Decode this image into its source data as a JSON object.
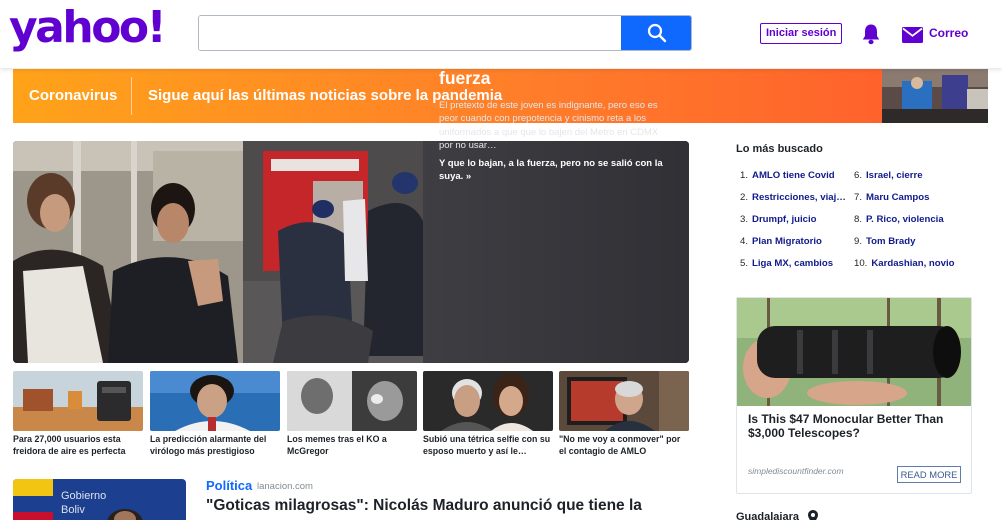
{
  "header": {
    "logo": "yahoo!",
    "search_placeholder": "",
    "signin_label": "Iniciar sesión",
    "mail_label": "Correo"
  },
  "banner": {
    "tag": "Coronavirus",
    "text": "Sigue aquí las últimas noticias sobre la pandemia"
  },
  "hero": {
    "title": "No usa mascarilla; reta a que lo bajen. Lo bajan con fuerza",
    "summary": "El pretexto de este joven es indignante, pero eso es peor cuando con prepotencia y cinismo reta a los uniformados a que que lo bajen del Metro en CDMX por no usar…",
    "link": "Y que lo bajan, a la fuerza, pero no se salió con la suya. »"
  },
  "thumbnails": [
    {
      "caption": "Para 27,000 usuarios esta freidora de aire es perfecta"
    },
    {
      "caption": "La predicción alarmante del virólogo más prestigioso"
    },
    {
      "caption": "Los memes tras el KO a McGregor"
    },
    {
      "caption": "Subió una tétrica selfie con su esposo muerto y así le…"
    },
    {
      "caption": "\"No me voy a conmover\" por el contagio de AMLO"
    }
  ],
  "story": {
    "category": "Política",
    "source": "lanacion.com",
    "title": "\"Goticas milagrosas\": Nicolás Maduro anunció que tiene la"
  },
  "trending": {
    "title": "Lo más buscado",
    "items": [
      {
        "num": "1.",
        "label": "AMLO tiene Covid"
      },
      {
        "num": "2.",
        "label": "Restricciones, viaj…"
      },
      {
        "num": "3.",
        "label": "Drumpf, juicio"
      },
      {
        "num": "4.",
        "label": "Plan Migratorio"
      },
      {
        "num": "5.",
        "label": "Liga MX, cambios"
      },
      {
        "num": "6.",
        "label": "Israel, cierre"
      },
      {
        "num": "7.",
        "label": "Maru Campos"
      },
      {
        "num": "8.",
        "label": "P. Rico, violencia"
      },
      {
        "num": "9.",
        "label": "Tom Brady"
      },
      {
        "num": "10.",
        "label": "Kardashian, novio"
      }
    ]
  },
  "ad": {
    "title": "Is This $47 Monocular Better Than $3,000 Telescopes?",
    "sponsor": "simplediscountfinder.com",
    "button": "READ MORE"
  },
  "weather": {
    "location": "Guadalajara"
  },
  "colors": {
    "brand": "#6001d2",
    "search_button": "#0f69ff",
    "banner_start": "#ffa31a",
    "banner_end": "#ff5a2c",
    "trend_link": "#0f1b8c"
  },
  "icons": [
    "search-icon",
    "bell-icon",
    "mail-icon",
    "location-pin-icon"
  ]
}
